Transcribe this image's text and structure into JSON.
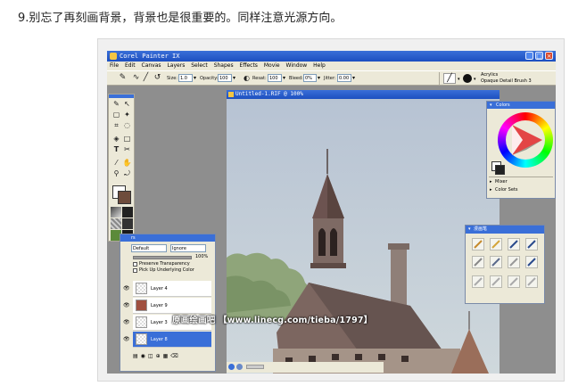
{
  "caption": "9.别忘了再刻画背景，背景也是很重要的。同样注意光源方向。",
  "app": {
    "title": "Corel Painter IX",
    "menus": [
      "File",
      "Edit",
      "Canvas",
      "Layers",
      "Select",
      "Shapes",
      "Effects",
      "Movie",
      "Window",
      "Help"
    ],
    "propbar": {
      "size_label": "Size:",
      "size_value": "1.0",
      "opacity_label": "Opacity:",
      "opacity_value": "100",
      "resat_label": "Resat:",
      "resat_value": "100",
      "bleed_label": "Bleed:",
      "bleed_value": "0%",
      "jitter_label": "Jitter:",
      "jitter_value": "0.00"
    },
    "brush_selector": {
      "category": "Acrylics",
      "variant": "Opaque Detail Brush 3"
    },
    "document": {
      "title": "Untitled-1.RIF @ 100%"
    },
    "layers_panel": {
      "title": "rs",
      "composite_method": "Default",
      "composite_depth": "Ignore",
      "opacity_value": "100%",
      "preserve_transparency": "Preserve Transparency",
      "pick_up_underlying": "Pick Up Underlying Color",
      "layers": [
        "Layer 4",
        "Layer 9",
        "Layer 3",
        "Layer 8"
      ],
      "selected_index": 3
    },
    "colors_panel": {
      "title": "Colors",
      "mixer": "Mixer",
      "color_sets": "Color Sets"
    },
    "brush_panel": {
      "title": "漫画笔"
    },
    "watermark": "原画绘画吧 【www.linecg.com/tieba/1797】"
  }
}
